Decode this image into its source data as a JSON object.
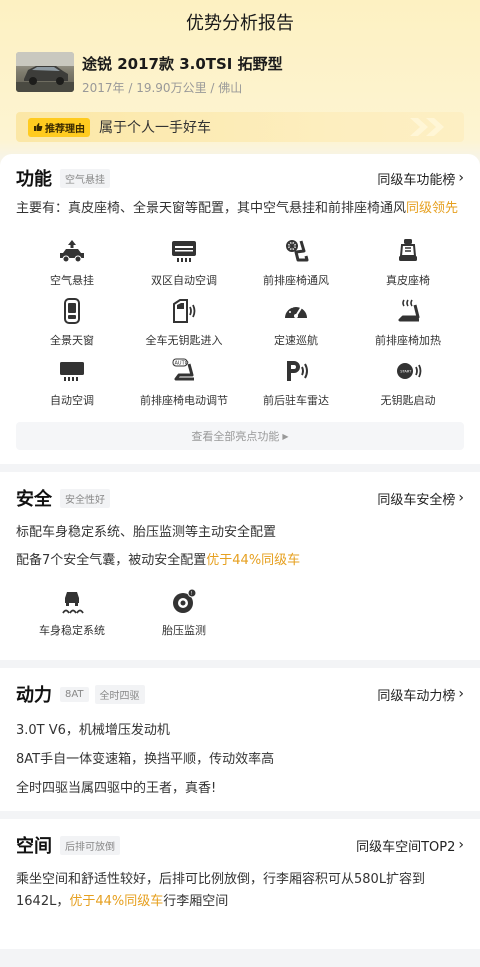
{
  "page_title": "优势分析报告",
  "car": {
    "name": "途锐 2017款 3.0TSI 拓野型",
    "meta": "2017年 / 19.90万公里 / 佛山"
  },
  "reason": {
    "tag": "推荐理由",
    "text": "属于个人一手好车"
  },
  "function": {
    "title": "功能",
    "tag": "空气悬挂",
    "link": "同级车功能榜",
    "desc_prefix": "主要有：真皮座椅、全景天窗等配置，其中空气悬挂和前排座椅通风",
    "desc_highlight": "同级领先",
    "features": [
      {
        "label": "空气悬挂",
        "icon": "air-suspension-icon"
      },
      {
        "label": "双区自动空调",
        "icon": "dual-zone-ac-icon"
      },
      {
        "label": "前排座椅通风",
        "icon": "seat-ventilation-icon"
      },
      {
        "label": "真皮座椅",
        "icon": "leather-seat-icon"
      },
      {
        "label": "全景天窗",
        "icon": "panoramic-sunroof-icon"
      },
      {
        "label": "全车无钥匙进入",
        "icon": "keyless-entry-icon"
      },
      {
        "label": "定速巡航",
        "icon": "cruise-control-icon"
      },
      {
        "label": "前排座椅加热",
        "icon": "seat-heating-icon"
      },
      {
        "label": "自动空调",
        "icon": "auto-ac-icon"
      },
      {
        "label": "前排座椅电动调节",
        "icon": "power-seat-icon"
      },
      {
        "label": "前后驻车雷达",
        "icon": "parking-radar-icon"
      },
      {
        "label": "无钥匙启动",
        "icon": "keyless-start-icon"
      }
    ],
    "more": "查看全部亮点功能"
  },
  "safety": {
    "title": "安全",
    "tag": "安全性好",
    "link": "同级车安全榜",
    "line1": "标配车身稳定系统、胎压监测等主动安全配置",
    "line2_prefix": "配备7个安全气囊，被动安全配置",
    "line2_highlight": "优于44%同级车",
    "features": [
      {
        "label": "车身稳定系统",
        "icon": "stability-control-icon"
      },
      {
        "label": "胎压监测",
        "icon": "tire-pressure-icon"
      }
    ]
  },
  "power": {
    "title": "动力",
    "tags": [
      "8AT",
      "全时四驱"
    ],
    "link": "同级车动力榜",
    "lines": [
      "3.0T V6，机械增压发动机",
      "8AT手自一体变速箱，换挡平顺，传动效率高",
      "全时四驱当属四驱中的王者，真香!"
    ]
  },
  "space": {
    "title": "空间",
    "tag": "后排可放倒",
    "link": "同级车空间TOP2",
    "desc_prefix": "乘坐空间和舒适性较好，后排可比例放倒，行李厢容积可从580L扩容到1642L，",
    "desc_highlight": "优于44%同级车",
    "desc_suffix": "行李厢空间"
  },
  "colors": {
    "highlight": "#e6a020",
    "tag_yellow": "#ffcb1f"
  }
}
